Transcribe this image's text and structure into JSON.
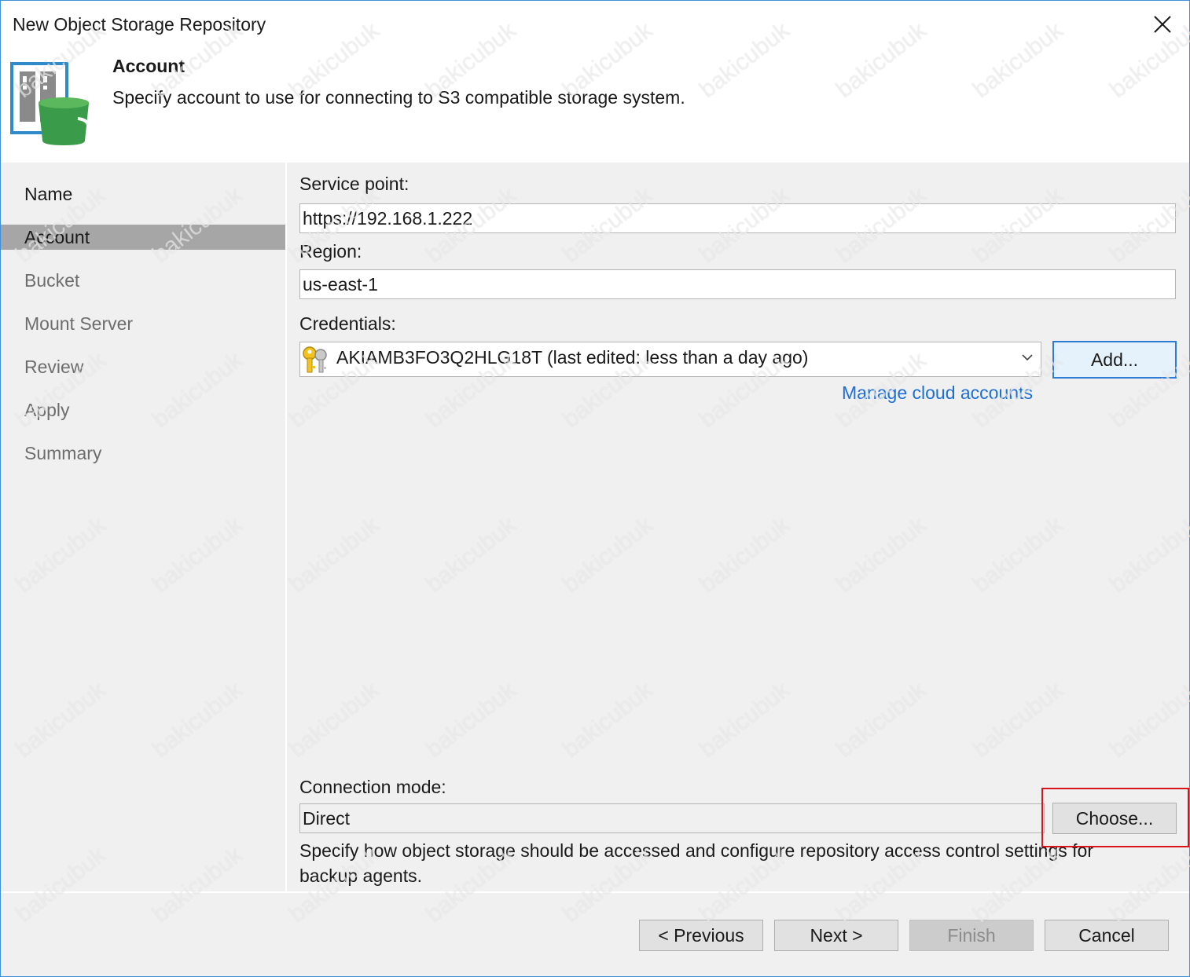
{
  "window": {
    "title": "New Object Storage Repository"
  },
  "header": {
    "title": "Account",
    "description": "Specify account to use for connecting to S3 compatible storage system."
  },
  "steps": [
    {
      "label": "Name",
      "state": "done"
    },
    {
      "label": "Account",
      "state": "active"
    },
    {
      "label": "Bucket",
      "state": "pending"
    },
    {
      "label": "Mount Server",
      "state": "pending"
    },
    {
      "label": "Review",
      "state": "pending"
    },
    {
      "label": "Apply",
      "state": "pending"
    },
    {
      "label": "Summary",
      "state": "pending"
    }
  ],
  "form": {
    "service_point_label": "Service point:",
    "service_point_value": "https://192.168.1.222",
    "region_label": "Region:",
    "region_value": "us-east-1",
    "credentials_label": "Credentials:",
    "credentials_value": "AKIAMB3FO3Q2HLG18T (last edited: less than a day ago)",
    "add_button": "Add...",
    "manage_link": "Manage cloud accounts",
    "connection_mode_label": "Connection mode:",
    "connection_mode_value": "Direct",
    "choose_button": "Choose...",
    "connection_hint": "Specify how object storage should be accessed and configure repository access control settings for backup agents."
  },
  "footer": {
    "previous": "< Previous",
    "next": "Next >",
    "finish": "Finish",
    "cancel": "Cancel"
  },
  "watermark": "bakicubuk",
  "colors": {
    "link": "#1c6ed8",
    "highlight": "#d9141b",
    "active_step": "#a6a6a6",
    "panel": "#f0f0f0",
    "window_border": "#3c8fd8"
  }
}
